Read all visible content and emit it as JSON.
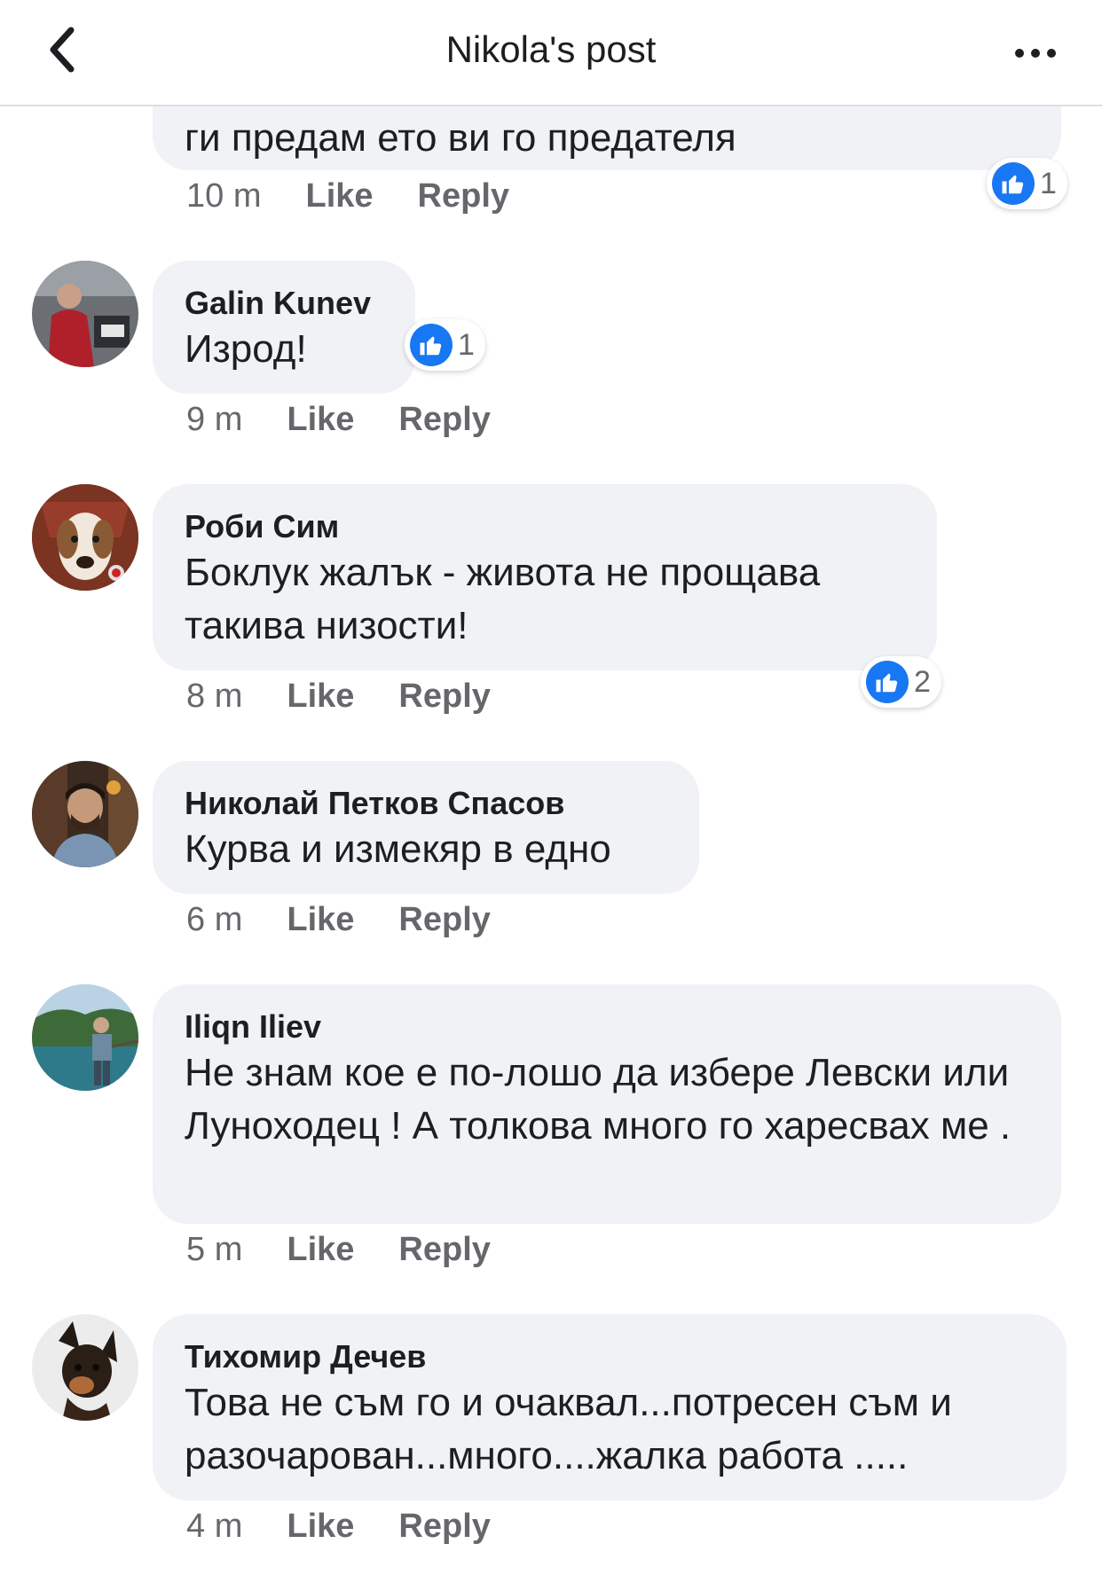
{
  "header": {
    "title": "Nikola's post",
    "back_icon": "chevron-left-icon",
    "more_icon": "more-icon"
  },
  "comments": [
    {
      "author": "",
      "text": "ги предам ето ви го предателя",
      "time": "10 m",
      "like_label": "Like",
      "reply_label": "Reply",
      "reactions": "1"
    },
    {
      "author": "Galin Kunev",
      "text": "Изрод!",
      "time": "9 m",
      "like_label": "Like",
      "reply_label": "Reply",
      "reactions": "1"
    },
    {
      "author": "Роби Сим",
      "text": "Боклук жалък - живота не прощава такива низости!",
      "time": "8 m",
      "like_label": "Like",
      "reply_label": "Reply",
      "reactions": "2"
    },
    {
      "author": "Николай Петков Спасов",
      "text": "Курва и измекяр в едно",
      "time": "6 m",
      "like_label": "Like",
      "reply_label": "Reply",
      "reactions": ""
    },
    {
      "author": "Iliqn Iliev",
      "text": "Не знам кое е по-лошо да избере Левски или Луноходец ! А толкова много го харесвах ме .",
      "time": "5 m",
      "like_label": "Like",
      "reply_label": "Reply",
      "reactions": ""
    },
    {
      "author": "Тихомир Дечев",
      "text": "Това не съм го и очаквал...потресен съм и разочарован...много....жалка работа .....",
      "time": "4 m",
      "like_label": "Like",
      "reply_label": "Reply",
      "reactions": ""
    }
  ],
  "colors": {
    "bubble": "#f0f2f5",
    "meta_text": "#65676b",
    "like_blue": "#1877f2"
  }
}
